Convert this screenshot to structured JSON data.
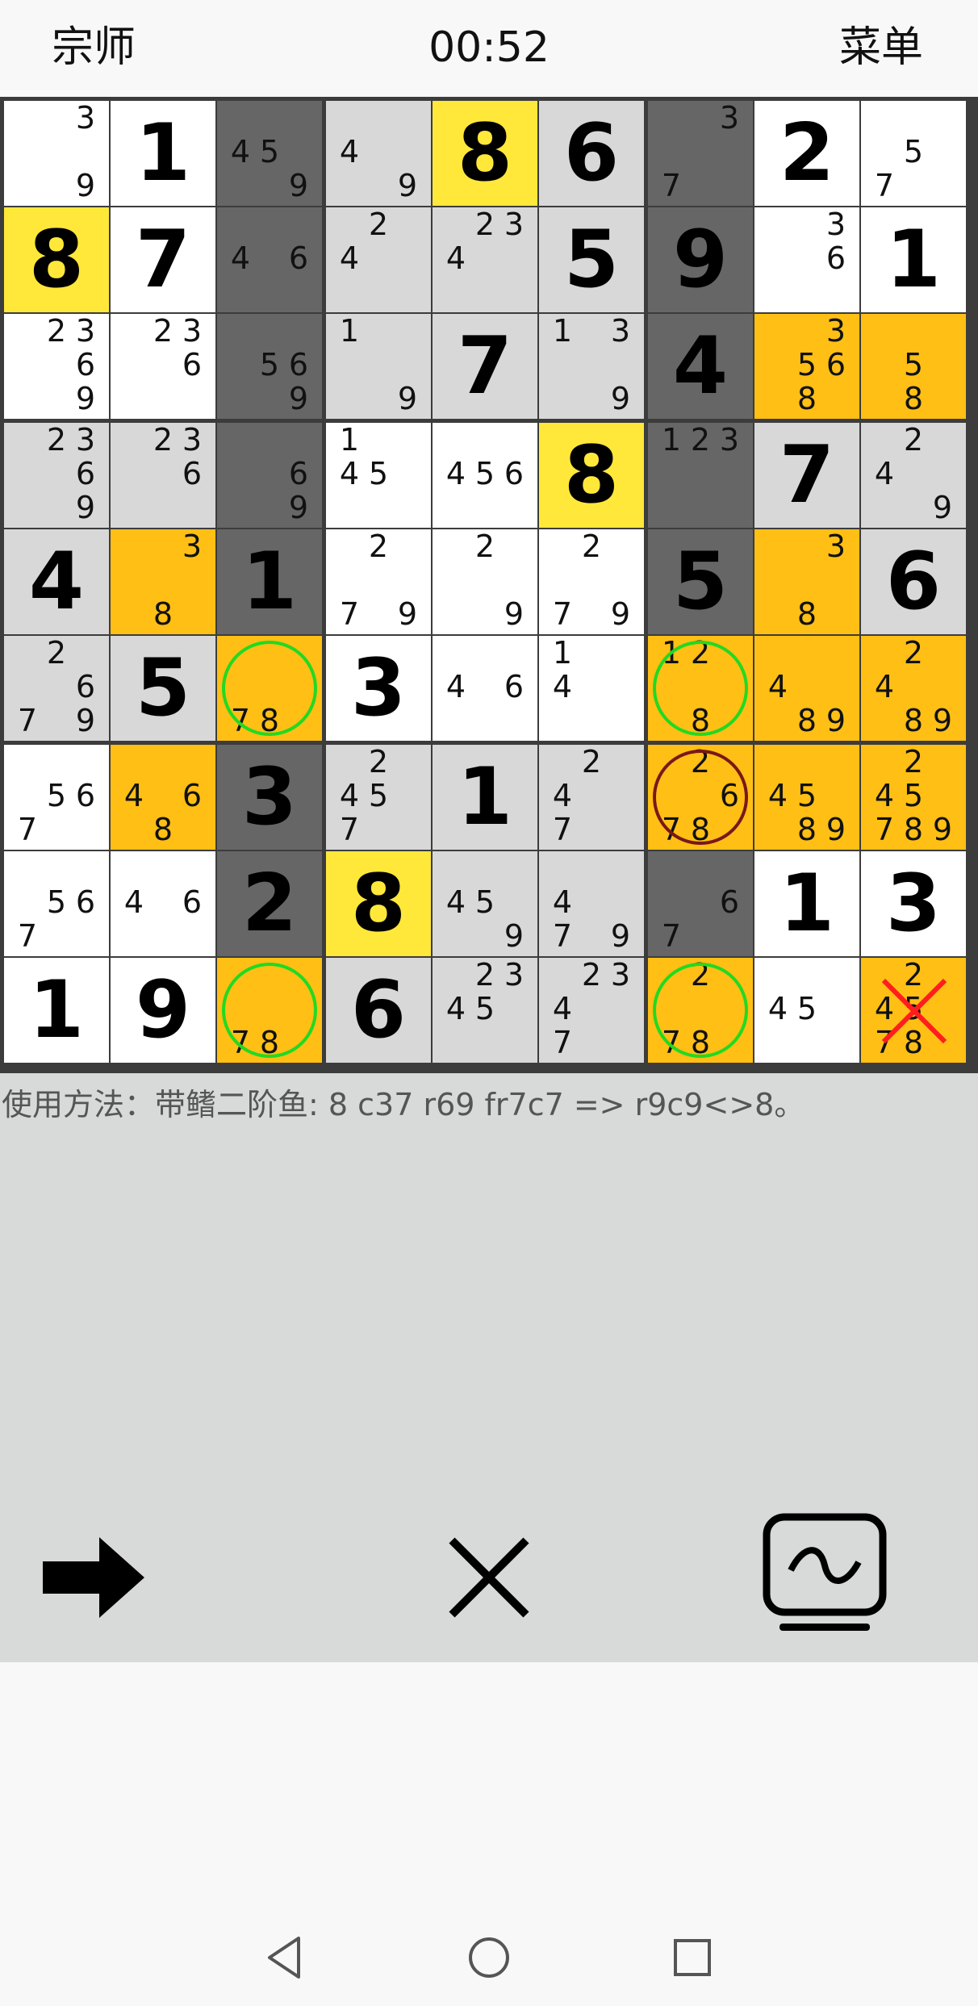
{
  "header": {
    "level": "宗师",
    "timer": "00:52",
    "menu": "菜单"
  },
  "colors": {
    "white": "#ffffff",
    "light_gray": "#d8d8d9",
    "dark_gray": "#666666",
    "yellow": "#ffe83a",
    "orange": "#ffbf14",
    "green_ring": "#22d922",
    "red_ring": "#7a1818",
    "red_cross": "#ff1d1d"
  },
  "board": {
    "rows": [
      [
        {
          "v": "",
          "c": [
            3,
            9
          ],
          "bg": "W"
        },
        {
          "v": "1",
          "c": [],
          "bg": "W"
        },
        {
          "v": "",
          "c": [
            4,
            5,
            9
          ],
          "bg": "D"
        },
        {
          "v": "",
          "c": [
            4,
            9
          ],
          "bg": "L"
        },
        {
          "v": "8",
          "c": [],
          "bg": "Y"
        },
        {
          "v": "6",
          "c": [],
          "bg": "L"
        },
        {
          "v": "",
          "c": [
            3,
            7
          ],
          "bg": "D"
        },
        {
          "v": "2",
          "c": [],
          "bg": "W"
        },
        {
          "v": "",
          "c": [
            5,
            7
          ],
          "bg": "W"
        }
      ],
      [
        {
          "v": "8",
          "c": [],
          "bg": "Y"
        },
        {
          "v": "7",
          "c": [],
          "bg": "W"
        },
        {
          "v": "",
          "c": [
            4,
            6
          ],
          "bg": "D"
        },
        {
          "v": "",
          "c": [
            2,
            4
          ],
          "bg": "L"
        },
        {
          "v": "",
          "c": [
            2,
            3,
            4
          ],
          "bg": "L"
        },
        {
          "v": "5",
          "c": [],
          "bg": "L"
        },
        {
          "v": "9",
          "c": [],
          "bg": "D"
        },
        {
          "v": "",
          "c": [
            3,
            6
          ],
          "bg": "W"
        },
        {
          "v": "1",
          "c": [],
          "bg": "W"
        }
      ],
      [
        {
          "v": "",
          "c": [
            2,
            3,
            6,
            9
          ],
          "bg": "W"
        },
        {
          "v": "",
          "c": [
            2,
            3,
            6
          ],
          "bg": "W"
        },
        {
          "v": "",
          "c": [
            5,
            6,
            9
          ],
          "bg": "D"
        },
        {
          "v": "",
          "c": [
            1,
            9
          ],
          "bg": "L"
        },
        {
          "v": "7",
          "c": [],
          "bg": "L"
        },
        {
          "v": "",
          "c": [
            1,
            3,
            9
          ],
          "bg": "L"
        },
        {
          "v": "4",
          "c": [],
          "bg": "D"
        },
        {
          "v": "",
          "c": [
            3,
            5,
            6,
            8
          ],
          "bg": "O"
        },
        {
          "v": "",
          "c": [
            5,
            8
          ],
          "bg": "O"
        }
      ],
      [
        {
          "v": "",
          "c": [
            2,
            3,
            6,
            9
          ],
          "bg": "L"
        },
        {
          "v": "",
          "c": [
            2,
            3,
            6
          ],
          "bg": "L"
        },
        {
          "v": "",
          "c": [
            6,
            9
          ],
          "bg": "D"
        },
        {
          "v": "",
          "c": [
            1,
            4,
            5
          ],
          "bg": "W"
        },
        {
          "v": "",
          "c": [
            4,
            5,
            6
          ],
          "bg": "W"
        },
        {
          "v": "8",
          "c": [],
          "bg": "Y"
        },
        {
          "v": "",
          "c": [
            1,
            2,
            3
          ],
          "bg": "D"
        },
        {
          "v": "7",
          "c": [],
          "bg": "L"
        },
        {
          "v": "",
          "c": [
            2,
            4,
            9
          ],
          "bg": "L"
        }
      ],
      [
        {
          "v": "4",
          "c": [],
          "bg": "L"
        },
        {
          "v": "",
          "c": [
            3,
            8
          ],
          "bg": "O"
        },
        {
          "v": "1",
          "c": [],
          "bg": "D"
        },
        {
          "v": "",
          "c": [
            2,
            7,
            9
          ],
          "bg": "W"
        },
        {
          "v": "",
          "c": [
            2,
            9
          ],
          "bg": "W"
        },
        {
          "v": "",
          "c": [
            2,
            7,
            9
          ],
          "bg": "W"
        },
        {
          "v": "5",
          "c": [],
          "bg": "D"
        },
        {
          "v": "",
          "c": [
            3,
            8
          ],
          "bg": "O"
        },
        {
          "v": "6",
          "c": [],
          "bg": "L"
        }
      ],
      [
        {
          "v": "",
          "c": [
            2,
            6,
            7,
            9
          ],
          "bg": "L"
        },
        {
          "v": "5",
          "c": [],
          "bg": "L"
        },
        {
          "v": "",
          "c": [
            7,
            8
          ],
          "bg": "O",
          "mark": "green"
        },
        {
          "v": "3",
          "c": [],
          "bg": "W"
        },
        {
          "v": "",
          "c": [
            4,
            6
          ],
          "bg": "W"
        },
        {
          "v": "",
          "c": [
            1,
            4
          ],
          "bg": "W"
        },
        {
          "v": "",
          "c": [
            1,
            2,
            8
          ],
          "bg": "O",
          "mark": "green"
        },
        {
          "v": "",
          "c": [
            4,
            8,
            9
          ],
          "bg": "O"
        },
        {
          "v": "",
          "c": [
            2,
            4,
            8,
            9
          ],
          "bg": "O"
        }
      ],
      [
        {
          "v": "",
          "c": [
            5,
            6,
            7
          ],
          "bg": "W"
        },
        {
          "v": "",
          "c": [
            4,
            6,
            8
          ],
          "bg": "O"
        },
        {
          "v": "3",
          "c": [],
          "bg": "D"
        },
        {
          "v": "",
          "c": [
            2,
            4,
            5,
            7
          ],
          "bg": "L"
        },
        {
          "v": "1",
          "c": [],
          "bg": "L"
        },
        {
          "v": "",
          "c": [
            2,
            4,
            7
          ],
          "bg": "L"
        },
        {
          "v": "",
          "c": [
            2,
            6,
            7,
            8
          ],
          "bg": "O",
          "mark": "red"
        },
        {
          "v": "",
          "c": [
            4,
            5,
            8,
            9
          ],
          "bg": "O"
        },
        {
          "v": "",
          "c": [
            2,
            4,
            5,
            7,
            8,
            9
          ],
          "bg": "O"
        }
      ],
      [
        {
          "v": "",
          "c": [
            5,
            6,
            7
          ],
          "bg": "W"
        },
        {
          "v": "",
          "c": [
            4,
            6
          ],
          "bg": "W"
        },
        {
          "v": "2",
          "c": [],
          "bg": "D"
        },
        {
          "v": "8",
          "c": [],
          "bg": "Y"
        },
        {
          "v": "",
          "c": [
            4,
            5,
            9
          ],
          "bg": "L"
        },
        {
          "v": "",
          "c": [
            4,
            7,
            9
          ],
          "bg": "L"
        },
        {
          "v": "",
          "c": [
            6,
            7
          ],
          "bg": "D"
        },
        {
          "v": "1",
          "c": [],
          "bg": "W"
        },
        {
          "v": "3",
          "c": [],
          "bg": "W"
        }
      ],
      [
        {
          "v": "1",
          "c": [],
          "bg": "W"
        },
        {
          "v": "9",
          "c": [],
          "bg": "W"
        },
        {
          "v": "",
          "c": [
            7,
            8
          ],
          "bg": "O",
          "mark": "green"
        },
        {
          "v": "6",
          "c": [],
          "bg": "L"
        },
        {
          "v": "",
          "c": [
            2,
            3,
            4,
            5
          ],
          "bg": "L"
        },
        {
          "v": "",
          "c": [
            2,
            3,
            4,
            7
          ],
          "bg": "L"
        },
        {
          "v": "",
          "c": [
            2,
            7,
            8
          ],
          "bg": "O",
          "mark": "green"
        },
        {
          "v": "",
          "c": [
            4,
            5
          ],
          "bg": "W"
        },
        {
          "v": "",
          "c": [
            2,
            4,
            5,
            7,
            8
          ],
          "bg": "O",
          "mark": "cross"
        }
      ]
    ]
  },
  "hint": "使用方法：带鳍二阶鱼: 8 c37 r69 fr7c7 => r9c9<>8。",
  "controls": {
    "next": "arrow-right-icon",
    "clear": "close-icon",
    "mode": "tv-wave-icon"
  },
  "nav": {
    "back": "nav-back-icon",
    "home": "nav-home-icon",
    "recent": "nav-recent-icon"
  }
}
